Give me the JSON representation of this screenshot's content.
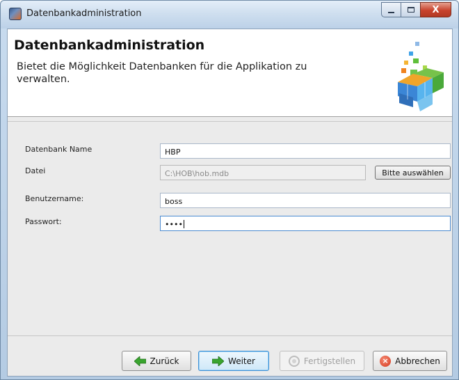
{
  "window": {
    "title": "Datenbankadministration",
    "caption_buttons": {
      "minimize": "",
      "maximize": "",
      "close": "X"
    }
  },
  "header": {
    "title": "Datenbankadministration",
    "description": "Bietet die Möglichkeit Datenbanken für die Applikation zu verwalten."
  },
  "form": {
    "db_name_label": "Datenbank Name",
    "db_name_value": "HBP",
    "file_label": "Datei",
    "file_value": "C:\\HOB\\hob.mdb",
    "browse_label": "Bitte auswählen",
    "username_label": "Benutzername:",
    "username_value": "boss",
    "password_label": "Passwort:",
    "password_value": "••••"
  },
  "footer": {
    "back_label": "Zurück",
    "next_label": "Weiter",
    "finish_label": "Fertigstellen",
    "cancel_label": "Abbrechen"
  },
  "colors": {
    "accent": "#3c8fd4",
    "arrow_green": "#3aa52f",
    "cancel_red": "#d4361c"
  },
  "icons": [
    "app-icon",
    "database-cubes-icon",
    "arrow-left-icon",
    "arrow-right-icon",
    "gear-icon",
    "cancel-icon"
  ]
}
